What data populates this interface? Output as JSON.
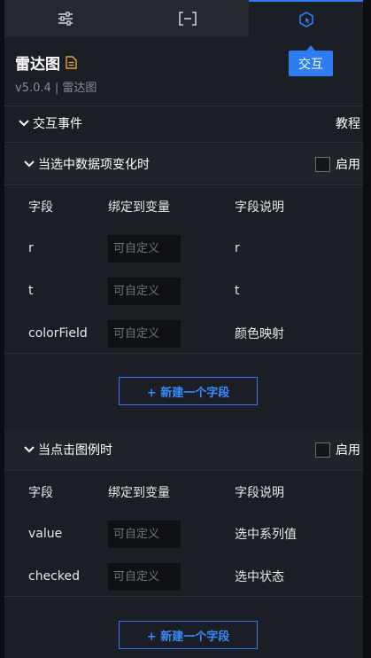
{
  "tabs": [
    {
      "name": "style-tab",
      "icon": "sliders-icon",
      "active": false
    },
    {
      "name": "data-tab",
      "icon": "bracket-icon",
      "active": false
    },
    {
      "name": "interaction-tab",
      "icon": "cursor-icon",
      "active": true
    }
  ],
  "tooltip": "交互",
  "component": {
    "title": "雷达图",
    "version": "v5.0.4 | 雷达图"
  },
  "section": {
    "label": "交互事件",
    "tutorial": "教程"
  },
  "events": [
    {
      "title": "当选中数据项变化时",
      "enable_label": "启用",
      "headers": [
        "字段",
        "绑定到变量",
        "字段说明"
      ],
      "fields": [
        {
          "field": "r",
          "placeholder": "可自定义",
          "desc": "r"
        },
        {
          "field": "t",
          "placeholder": "可自定义",
          "desc": "t"
        },
        {
          "field": "colorField",
          "placeholder": "可自定义",
          "desc": "颜色映射"
        }
      ],
      "add_label": "+ 新建一个字段"
    },
    {
      "title": "当点击图例时",
      "enable_label": "启用",
      "headers": [
        "字段",
        "绑定到变量",
        "字段说明"
      ],
      "fields": [
        {
          "field": "value",
          "placeholder": "可自定义",
          "desc": "选中系列值"
        },
        {
          "field": "checked",
          "placeholder": "可自定义",
          "desc": "选中状态"
        }
      ],
      "add_label": "+ 新建一个字段"
    }
  ],
  "colors": {
    "accent": "#2e7cf4",
    "doc_icon": "#e8a33a"
  }
}
